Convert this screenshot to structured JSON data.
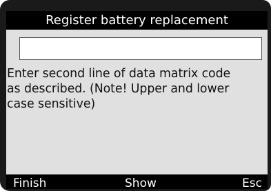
{
  "screen": {
    "title": "Register battery replacement",
    "input": {
      "value": ""
    },
    "message": "Enter second line of data matrix code\nas described. (Note! Upper and lower\ncase sensitive)",
    "colors": {
      "background": "#e0e0e0",
      "bars": "#000000",
      "bar_text": "#ffffff"
    }
  },
  "softkeys": {
    "finish": "Finish",
    "show": "Show",
    "esc": "Esc"
  }
}
